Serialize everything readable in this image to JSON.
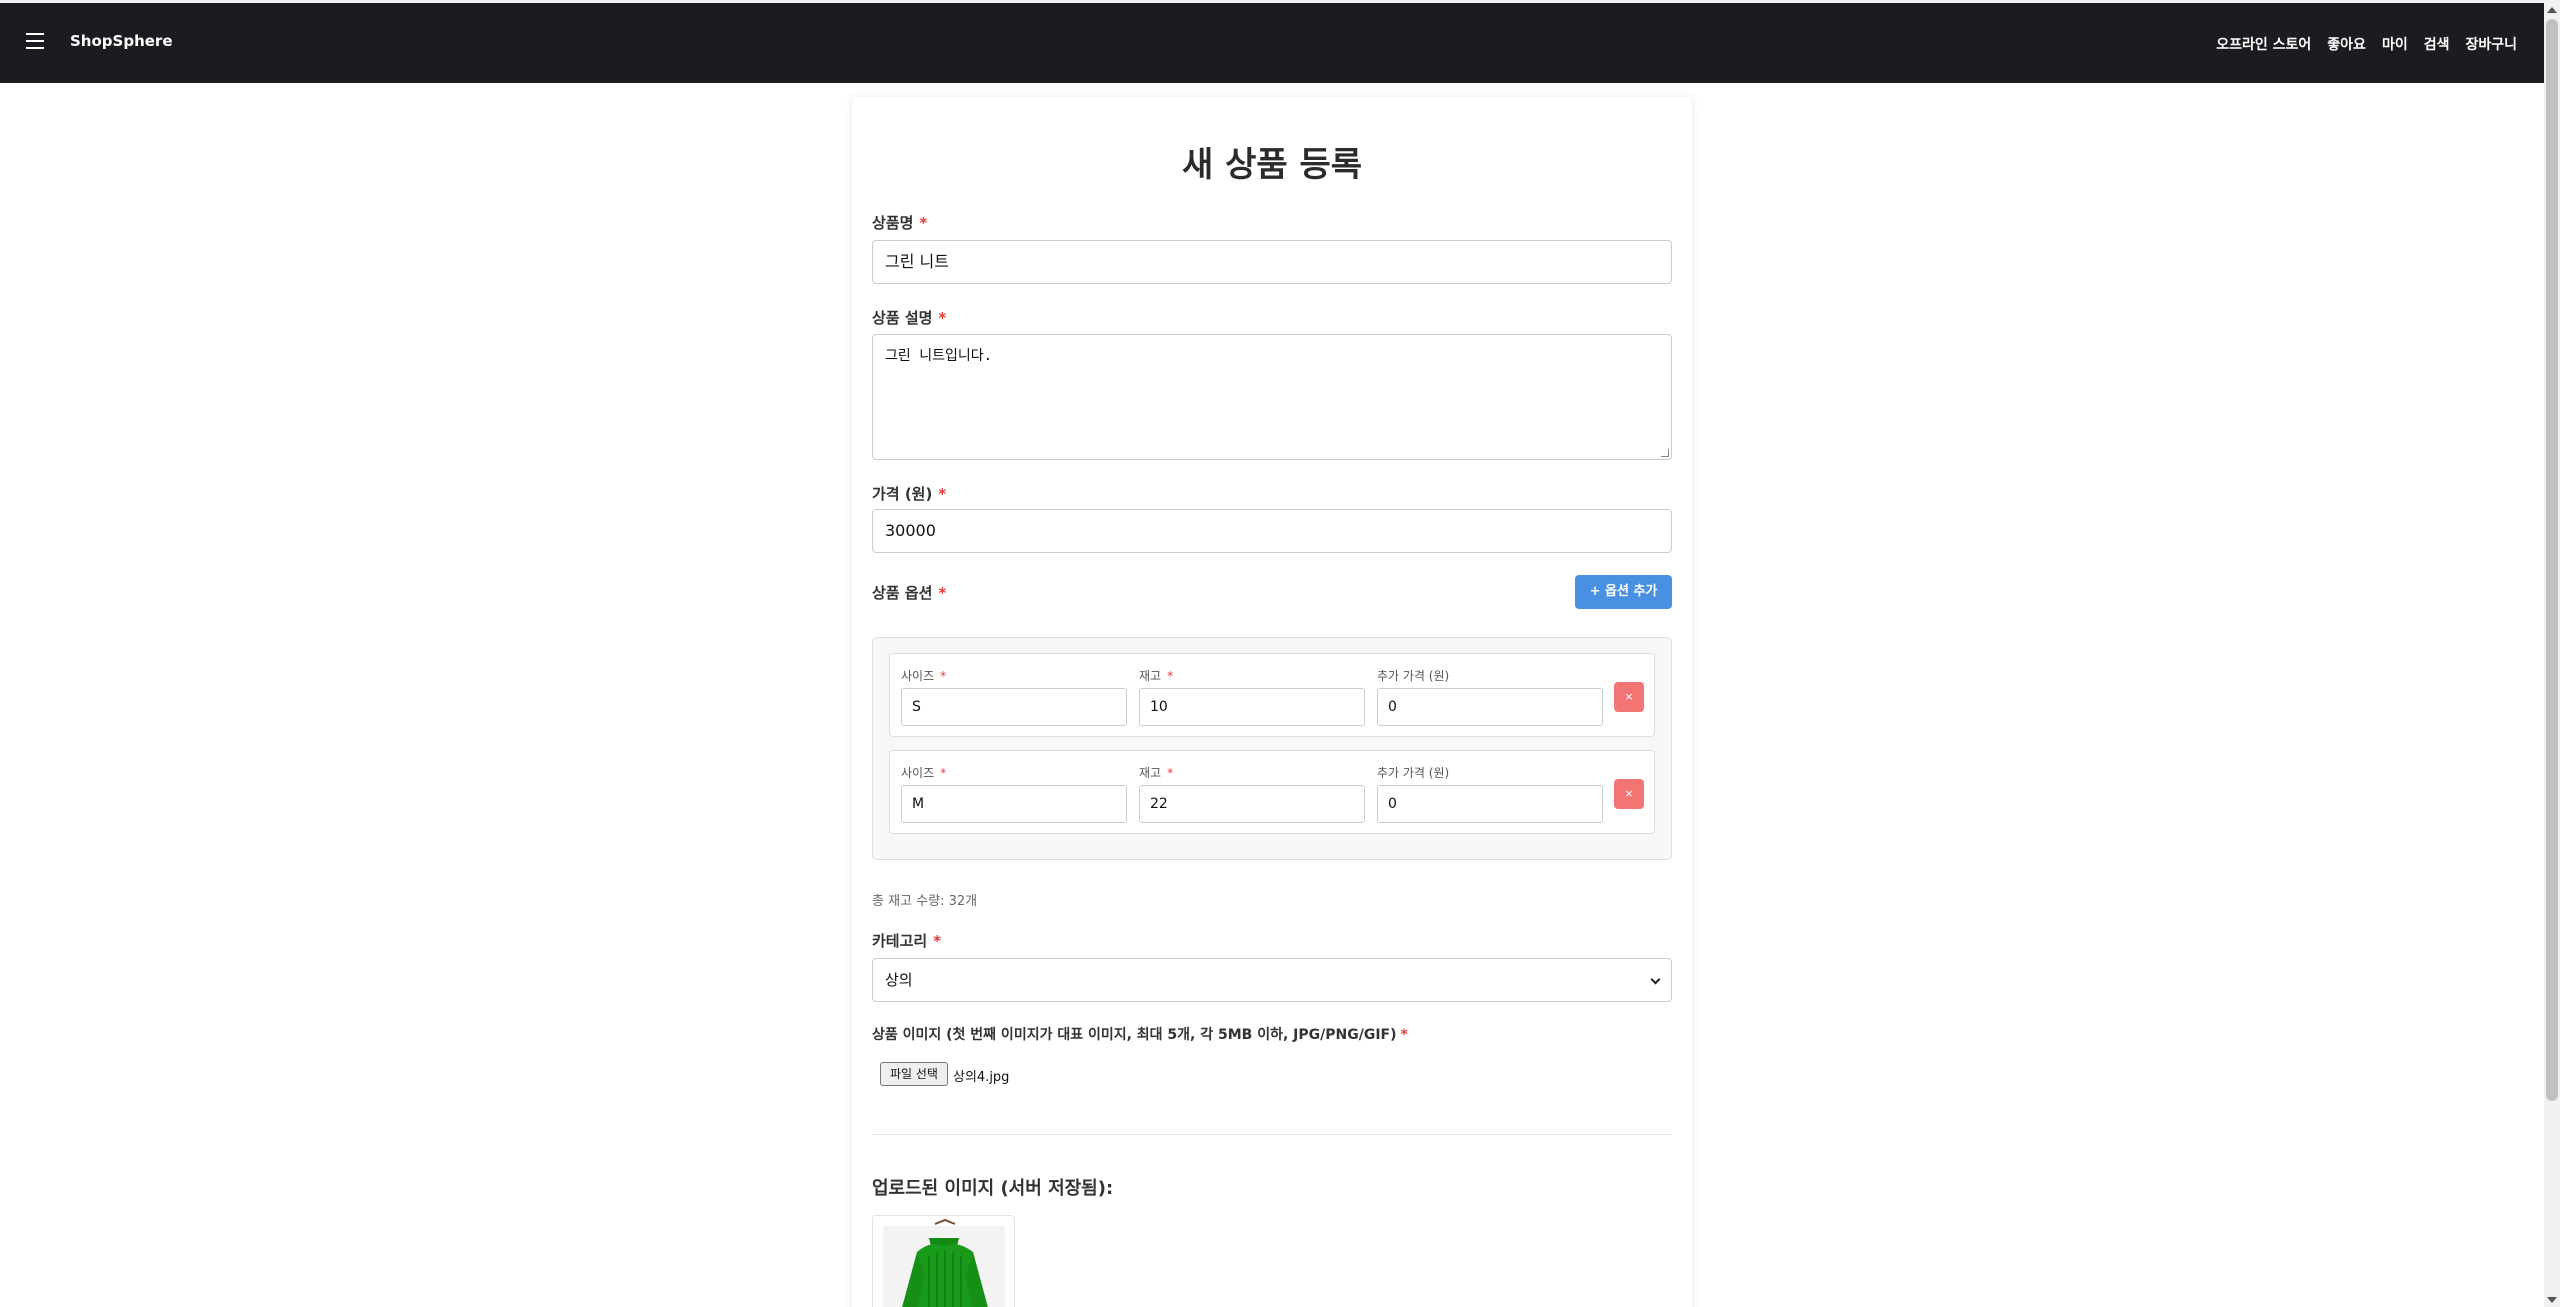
{
  "navbar": {
    "brand": "ShopSphere",
    "links": [
      "오프라인 스토어",
      "좋아요",
      "마이",
      "검색",
      "장바구니"
    ]
  },
  "form": {
    "title": "새 상품 등록",
    "required_mark": "*",
    "name": {
      "label": "상품명",
      "value": "그린 니트"
    },
    "description": {
      "label": "상품 설명",
      "value": "그린 니트입니다."
    },
    "price": {
      "label": "가격 (원)",
      "value": "30000"
    },
    "options": {
      "label": "상품 옵션",
      "add_button": "+ 옵션 추가",
      "size_label": "사이즈",
      "stock_label": "재고",
      "extra_price_label": "추가 가격 (원)",
      "delete_button": "×",
      "rows": [
        {
          "size": "S",
          "stock": "10",
          "extra_price": "0"
        },
        {
          "size": "M",
          "stock": "22",
          "extra_price": "0"
        }
      ]
    },
    "total_stock": "총 재고 수량: 32개",
    "category": {
      "label": "카테고리",
      "value": "상의"
    },
    "images": {
      "label": "상품 이미지 (첫 번째 이미지가 대표 이미지, 최대 5개, 각 5MB 이하, JPG/PNG/GIF)",
      "file_button": "파일 선택",
      "file_name": "상의4.jpg"
    },
    "uploaded": {
      "title": "업로드된 이미지 (서버 저장됨):"
    }
  },
  "colors": {
    "navbar_bg": "#1b1c1f",
    "primary_button": "#4a90e2",
    "delete_button": "#f27474",
    "required": "#e53935",
    "product_green": "#1a9a1a"
  }
}
